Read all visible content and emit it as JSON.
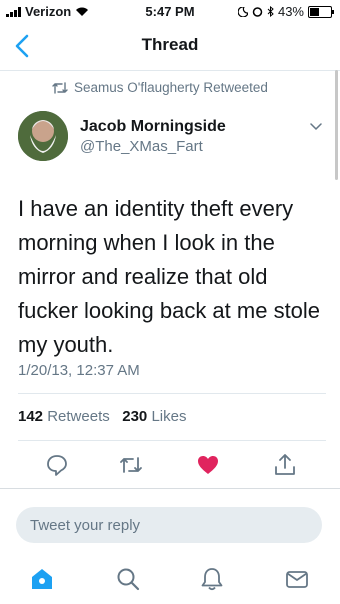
{
  "status_bar": {
    "carrier": "Verizon",
    "time": "5:47 PM",
    "battery_percent": "43%",
    "battery_level": 0.43
  },
  "nav": {
    "title": "Thread"
  },
  "tweet": {
    "retweeted_by": "Seamus O'flaugherty Retweeted",
    "author_name": "Jacob Morningside",
    "author_handle": "@The_XMas_Fart",
    "text": "I have an identity theft every morning when I look in the mirror and realize that old fucker looking back at me stole my youth.",
    "timestamp": "1/20/13, 12:37 AM",
    "retweets_count": "142",
    "retweets_label": "Retweets",
    "likes_count": "230",
    "likes_label": "Likes",
    "liked": true
  },
  "reply": {
    "placeholder": "Tweet your reply"
  },
  "colors": {
    "accent": "#1da1f2",
    "like": "#e0245e",
    "muted": "#657786",
    "home_active": "#1da1f2"
  },
  "icons": {
    "back": "chevron-left-icon",
    "retweet": "retweet-icon",
    "caret": "chevron-down-icon",
    "reply": "reply-icon",
    "like": "heart-icon",
    "share": "share-icon",
    "home": "home-icon",
    "search": "search-icon",
    "notifications": "bell-icon",
    "messages": "mail-icon"
  }
}
